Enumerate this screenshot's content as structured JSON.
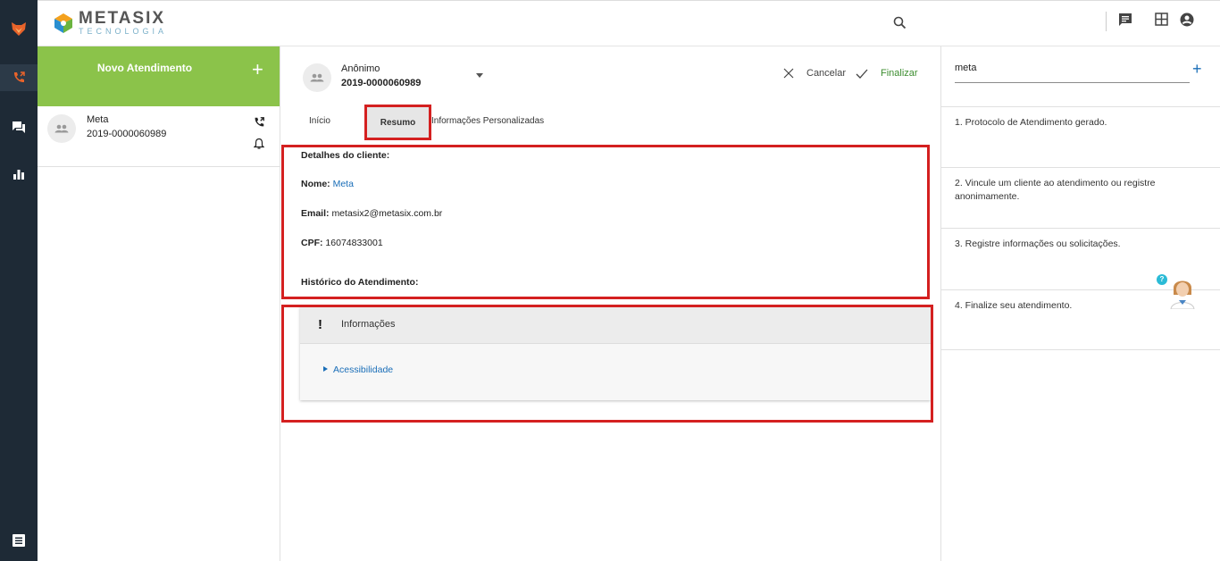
{
  "app": {
    "logo_main": "METASIX",
    "logo_sub": "TECNOLOGIA"
  },
  "rail": {
    "icons": [
      "brand-fox-icon",
      "phone-forward-icon",
      "chat-icon",
      "bar-chart-icon",
      "list-icon"
    ]
  },
  "header": {
    "icons": [
      "search-icon",
      "message-icon",
      "grid-icon",
      "account-icon"
    ]
  },
  "conversations": {
    "new_label": "Novo Atendimento",
    "new_plus": "+",
    "items": [
      {
        "name": "Meta",
        "protocol": "2019-0000060989"
      }
    ]
  },
  "ticket": {
    "customer_name": "Anônimo",
    "protocol": "2019-0000060989",
    "cancel_label": "Cancelar",
    "finalize_label": "Finalizar",
    "tabs": [
      "Início",
      "Resumo",
      "Informações Personalizadas"
    ],
    "active_tab": "Resumo"
  },
  "details": {
    "heading": "Detalhes do cliente:",
    "name_label": "Nome:",
    "name_value": "Meta",
    "email_label": "Email:",
    "email_value": "metasix2@metasix.com.br",
    "cpf_label": "CPF:",
    "cpf_value": "16074833001",
    "history_heading": "Histórico do Atendimento:"
  },
  "info_panel": {
    "mark": "!",
    "title": "Informações",
    "link": "Acessibilidade"
  },
  "right_panel": {
    "search_value": "meta",
    "plus": "+",
    "steps": [
      "1. Protocolo de Atendimento gerado.",
      "2. Vincule um cliente ao atendimento ou registre anonimamente.",
      "3. Registre informações ou solicitações.",
      "4. Finalize seu atendimento."
    ],
    "helper_badge": "?"
  },
  "colors": {
    "rail": "#1e2a36",
    "accent_green": "#8bc34a",
    "finalize_green": "#3c8d2f",
    "highlight_red": "#d42020",
    "link_blue": "#1a6eb8"
  }
}
